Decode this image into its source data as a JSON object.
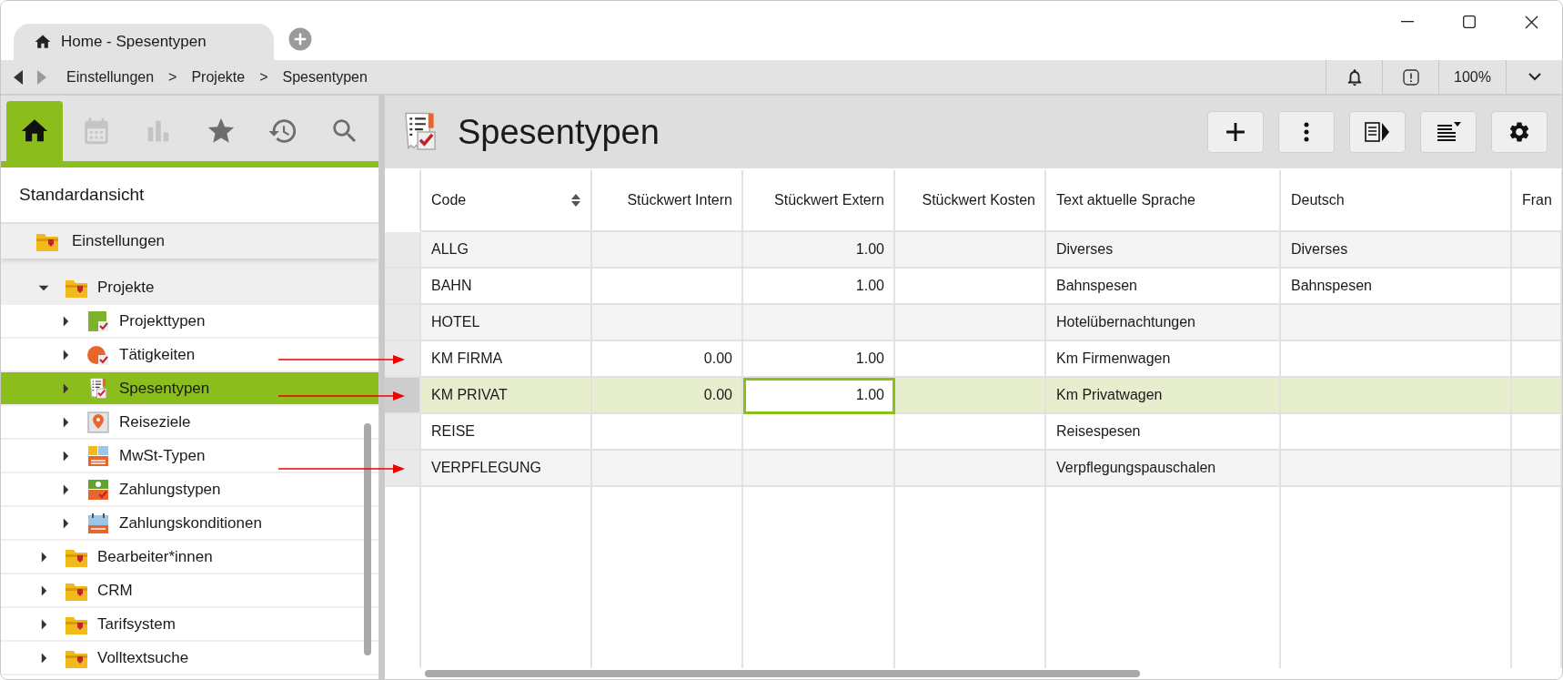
{
  "tabs": [
    {
      "title": "Home - Spesentypen",
      "selected": true
    }
  ],
  "navigation": [
    {
      "kind": "back",
      "disabled": false
    },
    {
      "kind": "forward",
      "disabled": true
    }
  ],
  "breadcrumb": [
    {
      "kind": "link",
      "text": "Einstellungen"
    },
    {
      "kind": "separator",
      "text": ">"
    },
    {
      "kind": "link",
      "text": "Projekte"
    },
    {
      "kind": "separator",
      "text": ">"
    },
    {
      "kind": "link",
      "text": "Spesentypen"
    }
  ],
  "status": {
    "zoom": "100%"
  },
  "sidebar": {
    "tabs": [
      {
        "kind": "home",
        "selected": true,
        "disabled": false
      },
      {
        "kind": "calendar",
        "selected": false,
        "disabled": true
      },
      {
        "kind": "chart",
        "selected": false,
        "disabled": true
      },
      {
        "kind": "favorites",
        "selected": false,
        "disabled": false
      },
      {
        "kind": "history",
        "selected": false,
        "disabled": false
      },
      {
        "kind": "search",
        "selected": false,
        "disabled": false
      }
    ],
    "view_title": "Standardansicht",
    "pinned_header": {
      "label": "Einstellungen",
      "kind": "folder"
    },
    "tree": [
      {
        "label": "Projekte",
        "kind": "folder",
        "expanded": true,
        "selected": false,
        "children": [
          {
            "label": "Projekttypen",
            "kind": "project-type",
            "expanded": false,
            "selected": false
          },
          {
            "label": "Tätigkeiten",
            "kind": "activity",
            "expanded": false,
            "selected": false
          },
          {
            "label": "Spesentypen",
            "kind": "expense",
            "expanded": false,
            "selected": true
          },
          {
            "label": "Reiseziele",
            "kind": "destination",
            "expanded": false,
            "selected": false
          },
          {
            "label": "MwSt-Typen",
            "kind": "vat",
            "expanded": false,
            "selected": false
          },
          {
            "label": "Zahlungstypen",
            "kind": "payment",
            "expanded": false,
            "selected": false
          },
          {
            "label": "Zahlungskonditionen",
            "kind": "calendar",
            "expanded": false,
            "selected": false
          }
        ]
      },
      {
        "label": "Bearbeiter*innen",
        "kind": "folder",
        "expanded": false,
        "selected": false
      },
      {
        "label": "CRM",
        "kind": "folder",
        "expanded": false,
        "selected": false
      },
      {
        "label": "Tarifsystem",
        "kind": "folder",
        "expanded": false,
        "selected": false
      },
      {
        "label": "Volltextsuche",
        "kind": "folder",
        "expanded": false,
        "selected": false
      }
    ]
  },
  "page": {
    "title": "Spesentypen"
  },
  "table": {
    "columns": [
      {
        "label": "Code",
        "kind": "text",
        "sortable": true
      },
      {
        "label": "Stückwert Intern",
        "kind": "number",
        "sortable": false
      },
      {
        "label": "Stückwert Extern",
        "kind": "number",
        "sortable": false
      },
      {
        "label": "Stückwert Kosten",
        "kind": "number",
        "sortable": false
      },
      {
        "label": "Text aktuelle Sprache",
        "kind": "text",
        "sortable": false
      },
      {
        "label": "Deutsch",
        "kind": "text",
        "sortable": false
      },
      {
        "label": "Fran",
        "kind": "text",
        "sortable": false
      }
    ],
    "rows": [
      {
        "selected": false,
        "marked": false,
        "cells": [
          {
            "text": "ALLG",
            "focused": false
          },
          {
            "focused": false
          },
          {
            "text": "1.00",
            "focused": false
          },
          {
            "focused": false
          },
          {
            "text": "Diverses",
            "focused": false
          },
          {
            "text": "Diverses",
            "focused": false
          },
          {
            "focused": false
          }
        ]
      },
      {
        "selected": false,
        "marked": false,
        "cells": [
          {
            "text": "BAHN",
            "focused": false
          },
          {
            "focused": false
          },
          {
            "text": "1.00",
            "focused": false
          },
          {
            "focused": false
          },
          {
            "text": "Bahnspesen",
            "focused": false
          },
          {
            "text": "Bahnspesen",
            "focused": false
          },
          {
            "focused": false
          }
        ]
      },
      {
        "selected": false,
        "marked": false,
        "cells": [
          {
            "text": "HOTEL",
            "focused": false
          },
          {
            "focused": false
          },
          {
            "focused": false
          },
          {
            "focused": false
          },
          {
            "text": "Hotelübernachtungen",
            "focused": false
          },
          {
            "focused": false
          },
          {
            "focused": false
          }
        ]
      },
      {
        "selected": false,
        "marked": true,
        "cells": [
          {
            "text": "KM FIRMA",
            "focused": false
          },
          {
            "text": "0.00",
            "focused": false
          },
          {
            "text": "1.00",
            "focused": false
          },
          {
            "focused": false
          },
          {
            "text": "Km Firmenwagen",
            "focused": false
          },
          {
            "focused": false
          },
          {
            "focused": false
          }
        ]
      },
      {
        "selected": true,
        "marked": true,
        "cells": [
          {
            "text": "KM PRIVAT",
            "focused": false
          },
          {
            "text": "0.00",
            "focused": false
          },
          {
            "text": "1.00",
            "focused": true
          },
          {
            "focused": false
          },
          {
            "text": "Km Privatwagen",
            "focused": false
          },
          {
            "focused": false
          },
          {
            "focused": false
          }
        ]
      },
      {
        "selected": false,
        "marked": false,
        "cells": [
          {
            "text": "REISE",
            "focused": false
          },
          {
            "focused": false
          },
          {
            "focused": false
          },
          {
            "focused": false
          },
          {
            "text": "Reisespesen",
            "focused": false
          },
          {
            "focused": false
          },
          {
            "focused": false
          }
        ]
      },
      {
        "selected": false,
        "marked": true,
        "cells": [
          {
            "text": "VERPFLEGUNG",
            "focused": false
          },
          {
            "focused": false
          },
          {
            "focused": false
          },
          {
            "focused": false
          },
          {
            "text": "Verpflegungspauschalen",
            "focused": false
          },
          {
            "focused": false
          },
          {
            "focused": false
          }
        ]
      }
    ]
  }
}
